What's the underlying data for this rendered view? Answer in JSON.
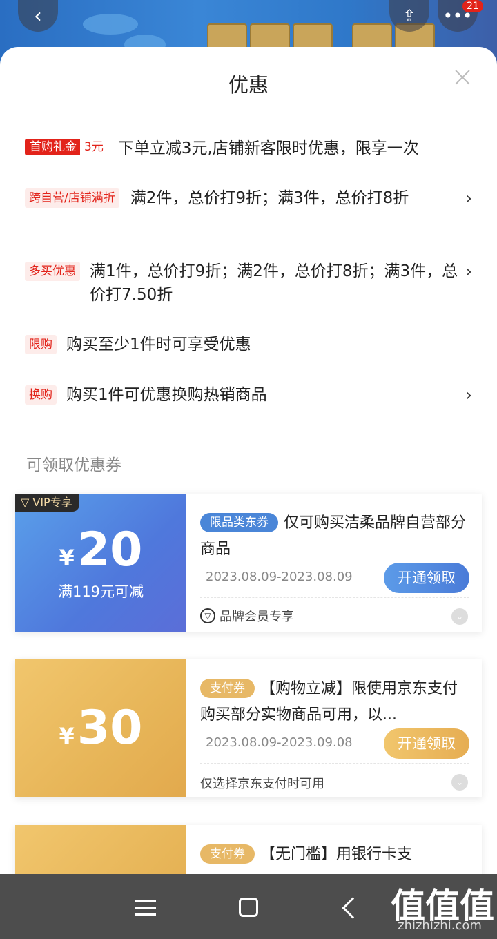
{
  "header": {
    "back_icon": "chevron-left-icon",
    "share_icon": "share-icon",
    "more_icon": "more-dots-icon",
    "badge": "21"
  },
  "sheet": {
    "title": "优惠",
    "close_icon": "close-icon"
  },
  "promotions": [
    {
      "tag": "首购礼金",
      "tag_amount": "3元",
      "text": "下单立减3元,店铺新客限时优惠，限享一次",
      "has_arrow": false
    },
    {
      "tag": "跨自营/店铺满折",
      "text": "满2件，总价打9折；满3件，总价打8折",
      "has_arrow": true
    },
    {
      "tag": "多买优惠",
      "text": "满1件，总价打9折；满2件，总价打8折；满3件，总价打7.50折",
      "has_arrow": true
    },
    {
      "tag": "限购",
      "text": "购买至少1件时可享受优惠",
      "has_arrow": false
    },
    {
      "tag": "换购",
      "text": "购买1件可优惠换购热销商品",
      "has_arrow": true
    }
  ],
  "coupons_section": {
    "label": "可领取优惠券",
    "coupons": [
      {
        "vip_label": "VIP专享",
        "currency": "¥",
        "amount": "20",
        "condition": "满119元可减",
        "type_tag": "限品类东券",
        "description": "仅可购买洁柔品牌自营部分商品",
        "date": "2023.08.09-2023.08.09",
        "button": "开通领取",
        "footer": "品牌会员专享",
        "color": "#4f78dc"
      },
      {
        "currency": "¥",
        "amount": "30",
        "type_tag": "支付券",
        "description": "【购物立减】限使用京东支付购买部分实物商品可用，以...",
        "date": "2023.08.09-2023.09.08",
        "button": "开通领取",
        "footer": "仅选择京东支付时可用",
        "color": "#e7b558"
      },
      {
        "type_tag": "支付券",
        "description": "【无门槛】用银行卡支",
        "color": "#e7b558"
      }
    ]
  },
  "navbar": {
    "menu_icon": "menu-icon",
    "home_icon": "home-square-icon",
    "back_icon": "back-triangle-icon",
    "watermark": "值值值",
    "watermark_sub": "zhizhizhi.com"
  },
  "colors": {
    "accent_red": "#e2231a",
    "coupon_blue": "#4f78dc",
    "coupon_gold": "#e7b558"
  }
}
